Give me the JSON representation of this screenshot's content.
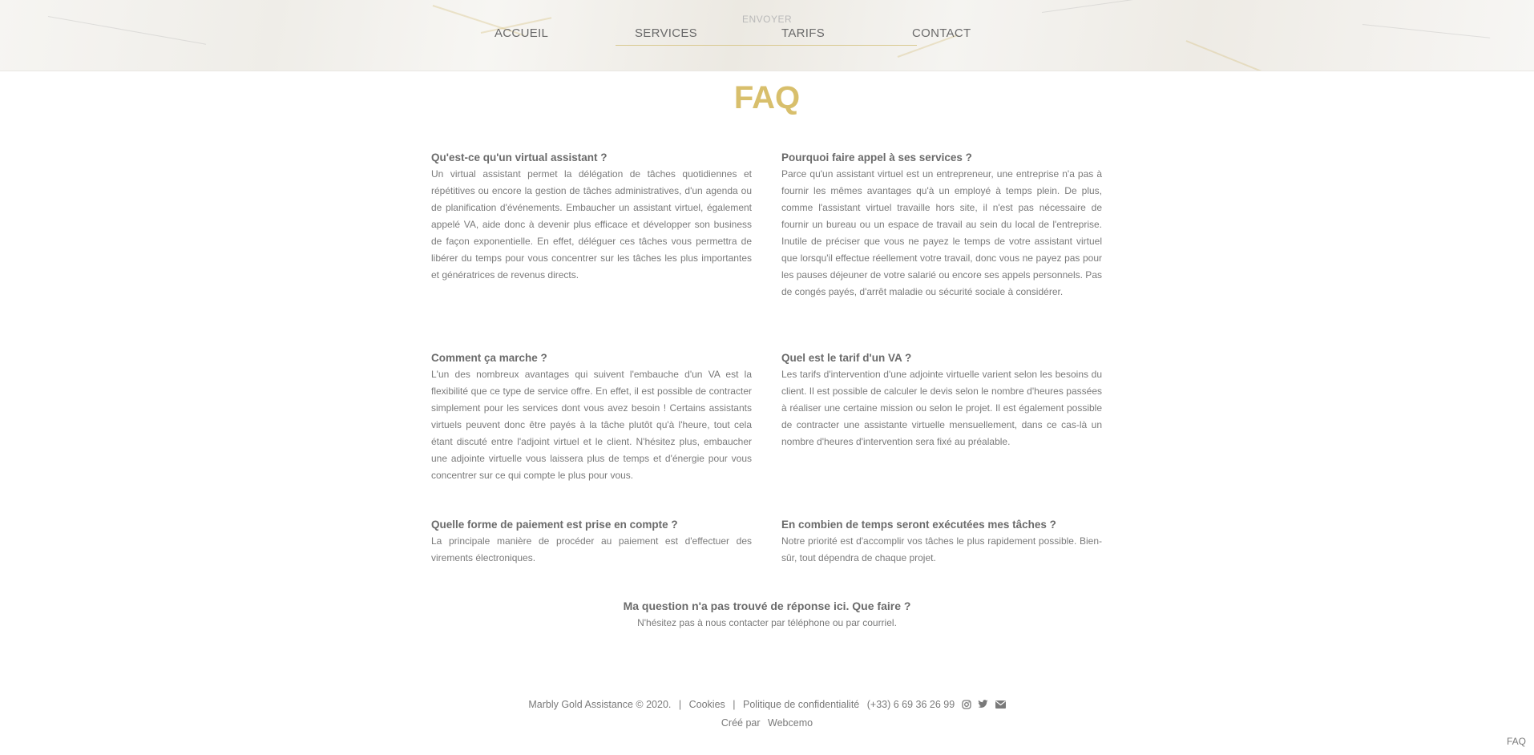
{
  "header": {
    "envoyer_label": "ENVOYER",
    "nav": {
      "accueil": "ACCUEIL",
      "services": "SERVICES",
      "tarifs": "TARIFS",
      "contact": "CONTACT"
    }
  },
  "page": {
    "title": "FAQ",
    "accent_color": "#d8bf6c"
  },
  "faq": [
    {
      "question": "Qu'est-ce qu'un virtual assistant ?",
      "answer": "Un virtual assistant permet la délégation de tâches quotidiennes et répétitives ou encore la gestion de tâches administratives, d'un agenda ou de planification d'événements. Embaucher un assistant virtuel, également appelé VA, aide donc à devenir plus efficace et développer son business de façon exponentielle. En effet, déléguer ces tâches vous permettra de libérer du temps pour vous concentrer sur les tâches les plus importantes et génératrices de revenus directs."
    },
    {
      "question": "Pourquoi faire appel à ses services ?",
      "answer": "Parce qu'un assistant virtuel est un entrepreneur, une entreprise n'a pas à fournir les mêmes avantages qu'à un employé à temps plein. De plus, comme l'assistant virtuel travaille hors site, il n'est pas nécessaire de fournir un bureau ou un espace de travail au sein du local de l'entreprise. Inutile de préciser que vous ne payez le temps de votre assistant virtuel que lorsqu'il effectue réellement votre travail, donc vous ne payez pas pour les pauses déjeuner de votre salarié ou encore ses appels personnels. Pas de congés payés, d'arrêt maladie ou sécurité sociale à considérer."
    },
    {
      "question": "Comment ça marche ?",
      "answer": "L'un des nombreux avantages qui suivent l'embauche d'un VA est la flexibilité que ce type de service offre. En effet, il est possible de contracter simplement pour les services dont vous avez besoin ! Certains assistants virtuels peuvent donc être payés à la tâche plutôt qu'à l'heure, tout cela étant discuté entre l'adjoint virtuel et le client. N'hésitez plus, embaucher une adjointe virtuelle vous laissera plus de temps et d'énergie pour vous concentrer sur ce qui compte le plus pour vous."
    },
    {
      "question": "Quel est le tarif d'un VA ?",
      "answer": "Les tarifs d'intervention d'une adjointe virtuelle varient selon les besoins du client. Il est possible de calculer le devis selon le nombre d'heures passées à réaliser une certaine mission ou selon le projet. Il est également possible de contracter une assistante virtuelle mensuellement, dans ce cas-là un nombre d'heures d'intervention sera fixé au préalable."
    },
    {
      "question": "Quelle forme de paiement est prise en compte ?",
      "answer": "La principale manière de procéder au paiement est d'effectuer des virements électroniques."
    },
    {
      "question": "En combien de temps seront exécutées mes tâches ?",
      "answer": "Notre priorité est d'accomplir vos tâches le plus rapidement possible. Bien-sûr, tout dépendra de chaque projet."
    }
  ],
  "cta": {
    "question": "Ma question n'a pas trouvé de réponse ici. Que faire ?",
    "answer": "N'hésitez pas à nous contacter par téléphone ou par courriel."
  },
  "footer": {
    "copyright": "Marbly Gold Assistance © 2020.",
    "sep": "|",
    "cookies": "Cookies",
    "privacy": "Politique de confidentialité",
    "phone": "(+33) 6 69 36 26 99",
    "created_by": "Créé par",
    "agency": "Webcemo",
    "icons": [
      "instagram-icon",
      "twitter-icon",
      "envelope-icon"
    ]
  },
  "corner_label": "FAQ"
}
